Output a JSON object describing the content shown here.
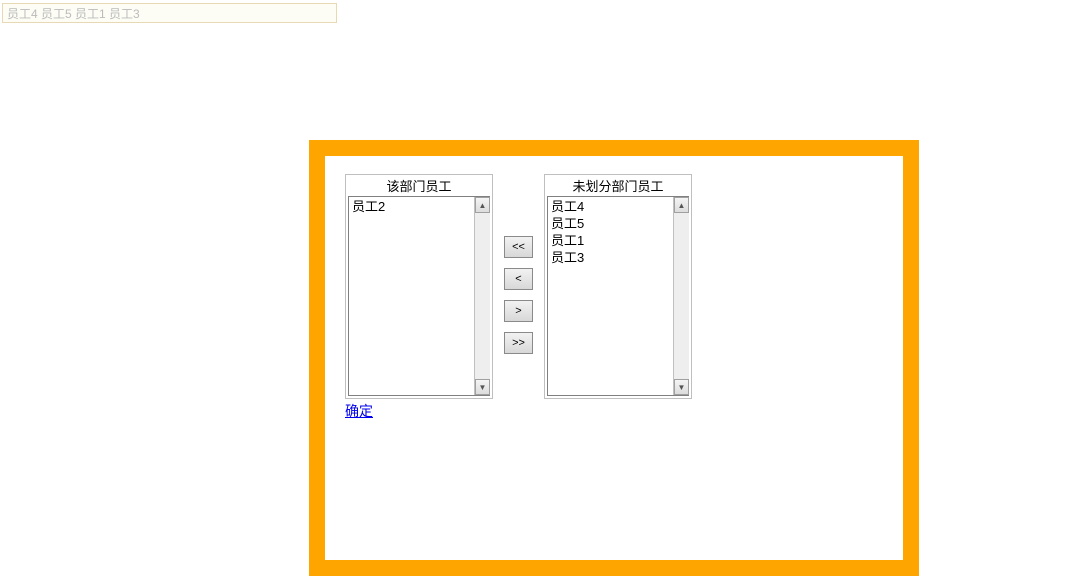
{
  "top_input": {
    "value": "员工4 员工5 员工1 员工3 "
  },
  "left_list": {
    "title": "该部门员工",
    "items": [
      "员工2"
    ]
  },
  "right_list": {
    "title": "未划分部门员工",
    "items": [
      "员工4",
      "员工5",
      "员工1",
      "员工3"
    ]
  },
  "buttons": {
    "move_all_left": "<<",
    "move_left": "<",
    "move_right": ">",
    "move_all_right": ">>"
  },
  "confirm": "确定"
}
